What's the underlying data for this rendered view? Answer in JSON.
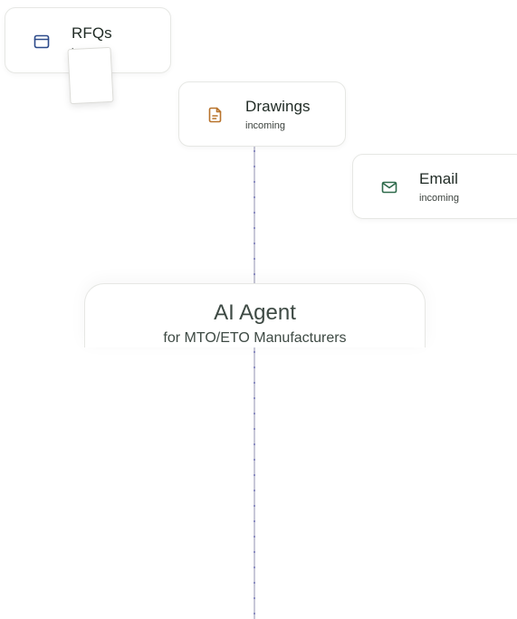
{
  "sources": [
    {
      "id": "rfqs",
      "title": "RFQs",
      "subtitle": "incoming",
      "icon": "browser-window-icon",
      "icon_color": "#2c4a8a"
    },
    {
      "id": "drawings",
      "title": "Drawings",
      "subtitle": "incoming",
      "icon": "document-icon",
      "icon_color": "#b8732b"
    },
    {
      "id": "email",
      "title": "Email",
      "subtitle": "incoming",
      "icon": "mail-icon",
      "icon_color": "#2f6b4c"
    }
  ],
  "agent": {
    "title": "AI Agent",
    "subtitle": "for MTO/ETO Manufacturers"
  },
  "colors": {
    "connector": "#c8c8d8",
    "connector_dot": "#8e8fc2",
    "card_border": "#e6e7e4",
    "text": "#1f2a24"
  }
}
